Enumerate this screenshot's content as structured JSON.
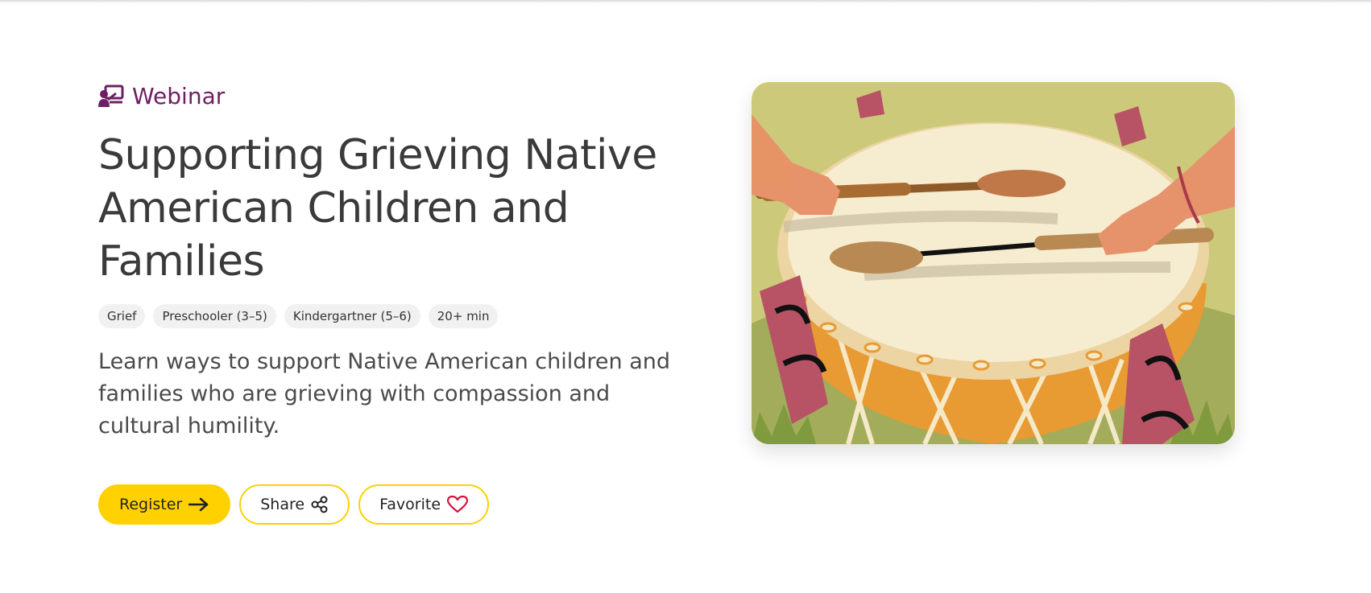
{
  "header": {
    "type_label": "Webinar",
    "type_icon": "presentation-icon",
    "accent_color": "#6e1f63"
  },
  "title": "Supporting Grieving Native American Children and Families",
  "tags": [
    "Grief",
    "Preschooler (3–5)",
    "Kindergartner (5–6)",
    "20+ min"
  ],
  "description": "Learn ways to support Native American children and families who are grieving with compassion and cultural humility.",
  "actions": {
    "register_label": "Register",
    "share_label": "Share",
    "favorite_label": "Favorite",
    "primary_color": "#ffd100"
  },
  "hero_image": {
    "alt": "Illustration of two hands playing a traditional drum with drumsticks"
  }
}
